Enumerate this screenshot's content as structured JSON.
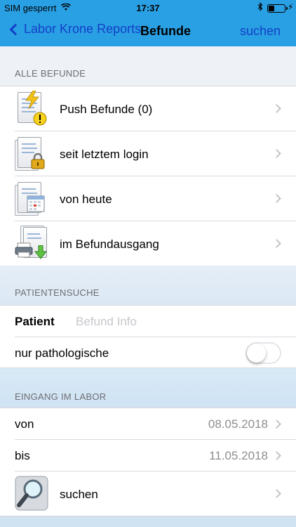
{
  "status_bar": {
    "carrier": "SIM gesperrt",
    "time": "17:37"
  },
  "nav": {
    "back_label": "Labor Krone Reports",
    "title": "Befunde",
    "action_label": "suchen"
  },
  "sections": {
    "alle_befunde": {
      "header": "ALLE BEFUNDE",
      "items": [
        {
          "label": "Push Befunde (0)",
          "icon": "push-befunde-icon"
        },
        {
          "label": "seit letztem login",
          "icon": "lock-document-icon"
        },
        {
          "label": "von heute",
          "icon": "calendar-document-icon"
        },
        {
          "label": "im Befundausgang",
          "icon": "printer-document-icon"
        }
      ]
    },
    "patientensuche": {
      "header": "PATIENTENSUCHE",
      "patient_label": "Patient",
      "patient_placeholder": "Befund Info",
      "pathologisch_label": "nur pathologische",
      "pathologisch_on": false
    },
    "eingang": {
      "header": "EINGANG IM LABOR",
      "von_label": "von",
      "von_value": "08.05.2018",
      "bis_label": "bis",
      "bis_value": "11.05.2018",
      "suchen_label": "suchen"
    }
  },
  "colors": {
    "nav_background": "#2aa0e4",
    "link_blue": "#1240c8"
  }
}
